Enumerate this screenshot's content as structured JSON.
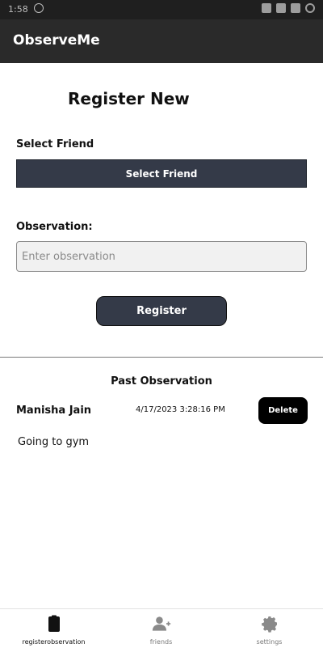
{
  "status_bar": {
    "time": "1:58"
  },
  "app": {
    "title": "ObserveMe"
  },
  "form": {
    "heading": "Register New",
    "select_friend_label": "Select Friend",
    "select_friend_button": "Select Friend",
    "observation_label": "Observation:",
    "observation_placeholder": "Enter observation",
    "observation_value": "",
    "register_button": "Register"
  },
  "past": {
    "title": "Past Observation",
    "items": [
      {
        "friend": "Manisha Jain",
        "timestamp": "4/17/2023 3:28:16 PM",
        "delete_label": "Delete",
        "text": "Going to gym"
      }
    ]
  },
  "nav": {
    "items": [
      {
        "label": "registerobservation",
        "icon": "clipboard-icon",
        "active": true
      },
      {
        "label": "friends",
        "icon": "add-friend-icon",
        "active": false
      },
      {
        "label": "settings",
        "icon": "gear-icon",
        "active": false
      }
    ]
  },
  "colors": {
    "app_bar": "#2a2a2a",
    "button": "#343a48",
    "delete_button": "#000000",
    "input_bg": "#f1f1f1"
  }
}
